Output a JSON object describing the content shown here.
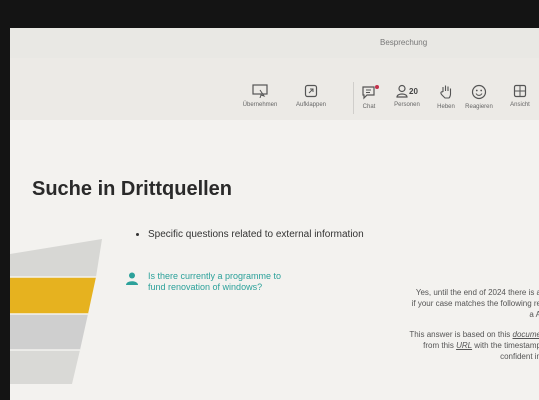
{
  "window": {
    "title": "Besprechung"
  },
  "toolbar": {
    "buttons": [
      {
        "label": "Übernehmen",
        "icon": "take-control-icon"
      },
      {
        "label": "Aufklappen",
        "icon": "pop-out-icon"
      },
      {
        "label": "Chat",
        "icon": "chat-icon"
      },
      {
        "label": "Personen",
        "icon": "people-icon",
        "count": "20"
      },
      {
        "label": "Heben",
        "icon": "raise-hand-icon"
      },
      {
        "label": "Reagieren",
        "icon": "react-icon"
      },
      {
        "label": "Ansicht",
        "icon": "view-icon"
      }
    ]
  },
  "slide": {
    "title": "Suche in Drittquellen",
    "bullet": "Specific questions related to external information",
    "question": {
      "line1": "Is there currently a programme to",
      "line2": "fund renovation of windows?"
    },
    "answer": {
      "line1": "Yes, until the end of 2024 there is a",
      "line2": "if your case matches the following re",
      "line3": "a A",
      "line4_prefix": "This answer is based on this ",
      "line4_link": "docume",
      "line5_prefix": "from this ",
      "line5_link": "URL",
      "line5_suffix": " with the timestamp",
      "line6": "confident in"
    }
  },
  "colors": {
    "accent": "#2ba19a",
    "funnel_yellow": "#e6b21f",
    "funnel_grey": "#cfcfcf",
    "screen_bg": "#f1f0ec"
  }
}
